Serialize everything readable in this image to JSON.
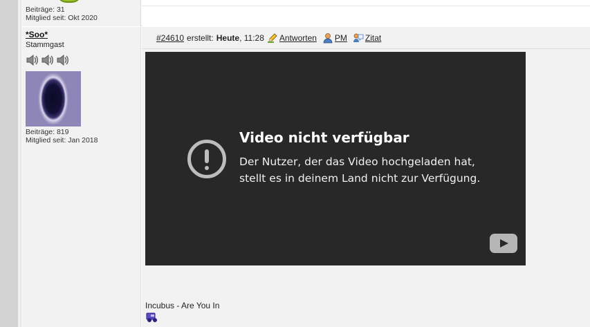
{
  "previous_post": {
    "posts_label": "Beiträge: 31",
    "member_since": "Mitglied seit: Okt 2020"
  },
  "post": {
    "user": {
      "name": "*Soo*",
      "rank": "Stammgast",
      "rank_icons": [
        "speaker-icon",
        "speaker-icon",
        "speaker-icon"
      ],
      "posts_label": "Beiträge: 819",
      "member_since": "Mitglied seit: Jan 2018"
    },
    "header": {
      "post_number": "#24610",
      "created_label": "erstellt:",
      "date": "Heute",
      "time": ", 11:28",
      "reply_label": "Antworten",
      "pm_label": "PM",
      "quote_label": "Zitat"
    },
    "video": {
      "title": "Video nicht verfügbar",
      "message_line1": "Der Nutzer, der das Video hochgeladen hat,",
      "message_line2": "stellt es in deinem Land nicht zur Verfügung."
    },
    "song": "Incubus - Are You In"
  }
}
